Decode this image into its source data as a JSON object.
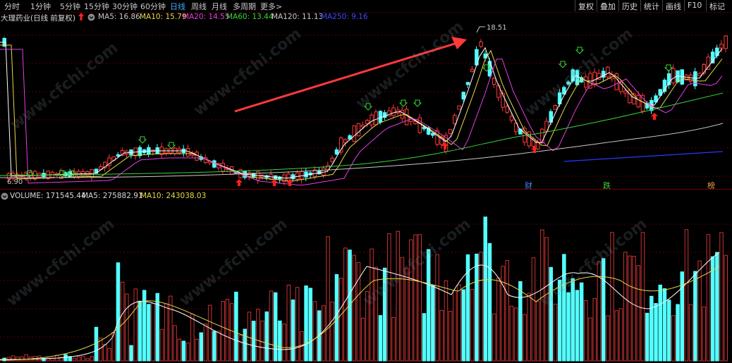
{
  "toolbar": {
    "timeframes": [
      "分时",
      "1分钟",
      "5分钟",
      "15分钟",
      "30分钟",
      "60分钟",
      "日线",
      "周线",
      "月线",
      "多周期",
      "更多>"
    ],
    "active_timeframe": "日线",
    "right_buttons": [
      "复权",
      "叠加",
      "历史",
      "统计",
      "画线",
      "F10",
      "标记"
    ]
  },
  "price_info": {
    "title": "大理药业(日线 前复权)",
    "ma5": "MA5: 16.86",
    "ma10": "MA10: 15.79",
    "ma20": "MA20: 14.55",
    "ma60": "MA60: 13.44",
    "ma120": "MA120: 11.13",
    "ma250": "MA250: 9.16",
    "colors": {
      "ma5": "#ffffff",
      "ma10": "#e6d84a",
      "ma20": "#e040e0",
      "ma60": "#36d636",
      "ma120": "#c8c8c8",
      "ma250": "#3a48ff"
    }
  },
  "volume_info": {
    "volume": "VOLUME: 171545.44",
    "ma5": "MA5: 275882.91",
    "ma10": "MA10: 243038.03"
  },
  "annotations": {
    "high_label": "18.51",
    "low_label": "6.90",
    "event_markers": [
      "财",
      "跌",
      "榜"
    ]
  },
  "watermark": "www.cfchi.com"
}
